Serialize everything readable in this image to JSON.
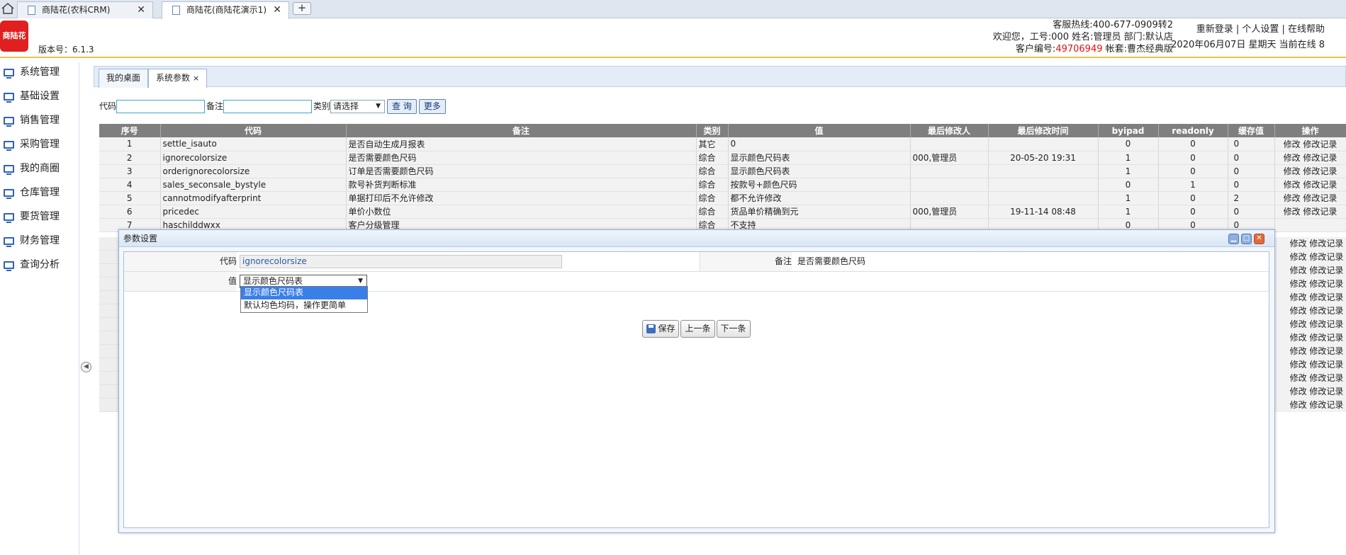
{
  "browser": {
    "tabs": [
      {
        "label": "商陆花(农科CRM)",
        "close": "✕"
      },
      {
        "label": "商陆花(商陆花演示1)",
        "close": "✕"
      }
    ],
    "new_tab": "+"
  },
  "header": {
    "logo_text": "商陆花",
    "version": "版本号：6.1.3",
    "hotline": "客服热线:400-677-0909转2",
    "welcome": "欢迎您，工号:000 姓名:管理员 部门:默认店",
    "customer_prefix": "客户编号:",
    "customer_no": "49706949",
    "customer_suffix": " 帐套:曹杰经典版",
    "links": "重新登录 | 个人设置 | 在线帮助",
    "datetime": "2020年06月07日 星期天 当前在线 8"
  },
  "sidebar": {
    "items": [
      "系统管理",
      "基础设置",
      "销售管理",
      "采购管理",
      "我的商圈",
      "仓库管理",
      "要货管理",
      "财务管理",
      "查询分析"
    ],
    "collapse": "◀"
  },
  "app_tabs": [
    {
      "label": "我的桌面"
    },
    {
      "label": "系统参数",
      "close": "×"
    }
  ],
  "search": {
    "code_label": "代码",
    "remark_label": "备注",
    "type_label": "类别",
    "type_value": "请选择",
    "query_button": "查 询",
    "more_button": "更多"
  },
  "table": {
    "headers": [
      "序号",
      "代码",
      "备注",
      "类别",
      "值",
      "最后修改人",
      "最后修改时间",
      "byipad",
      "readonly",
      "缓存值",
      "操作"
    ],
    "rows": [
      [
        "1",
        "settle_isauto",
        "是否自动生成月报表",
        "其它",
        "0",
        "",
        "",
        "0",
        "0",
        "0",
        "修改 修改记录"
      ],
      [
        "2",
        "ignorecolorsize",
        "是否需要颜色尺码",
        "综合",
        "显示颜色尺码表",
        "000,管理员",
        "20-05-20 19:31",
        "1",
        "0",
        "0",
        "修改 修改记录"
      ],
      [
        "3",
        "orderignorecolorsize",
        "订单是否需要颜色尺码",
        "综合",
        "显示颜色尺码表",
        "",
        "",
        "1",
        "0",
        "0",
        "修改 修改记录"
      ],
      [
        "4",
        "sales_seconsale_bystyle",
        "款号补货判断标准",
        "综合",
        "按款号+颜色尺码",
        "",
        "",
        "0",
        "1",
        "0",
        "修改 修改记录"
      ],
      [
        "5",
        "cannotmodifyafterprint",
        "单据打印后不允许修改",
        "综合",
        "都不允许修改",
        "",
        "",
        "1",
        "0",
        "2",
        "修改 修改记录"
      ],
      [
        "6",
        "pricedec",
        "单价小数位",
        "综合",
        "货品单价精确到元",
        "000,管理员",
        "19-11-14 08:48",
        "1",
        "0",
        "0",
        "修改 修改记录"
      ],
      [
        "7",
        "haschilddwxx",
        "客户分级管理",
        "综合",
        "不支持",
        "",
        "",
        "0",
        "0",
        "0",
        ""
      ]
    ],
    "hidden_row_ops": [
      "修改 修改记录",
      "修改 修改记录",
      "修改 修改记录",
      "修改 修改记录",
      "修改 修改记录",
      "修改 修改记录",
      "修改 修改记录",
      "修改 修改记录",
      "修改 修改记录",
      "修改 修改记录",
      "修改 修改记录",
      "修改 修改记录",
      "修改 修改记录"
    ]
  },
  "dialog": {
    "title": "参数设置",
    "code_label": "代码",
    "code_value": "ignorecolorsize",
    "remark_label": "备注",
    "remark_value": "是否需要颜色尺码",
    "value_label": "值",
    "value_selected": "显示颜色尺码表",
    "options": [
      "显示颜色尺码表",
      "默认均色均码，操作更简单"
    ],
    "save_button": "保存",
    "prev_button": "上一条",
    "next_button": "下一条"
  },
  "colors": {
    "accent": "#2f63b8",
    "header_rule": "#f0c24a",
    "table_header": "#7f7f7f",
    "customer_no": "#e01010",
    "option_highlight": "#3a7fe8"
  }
}
